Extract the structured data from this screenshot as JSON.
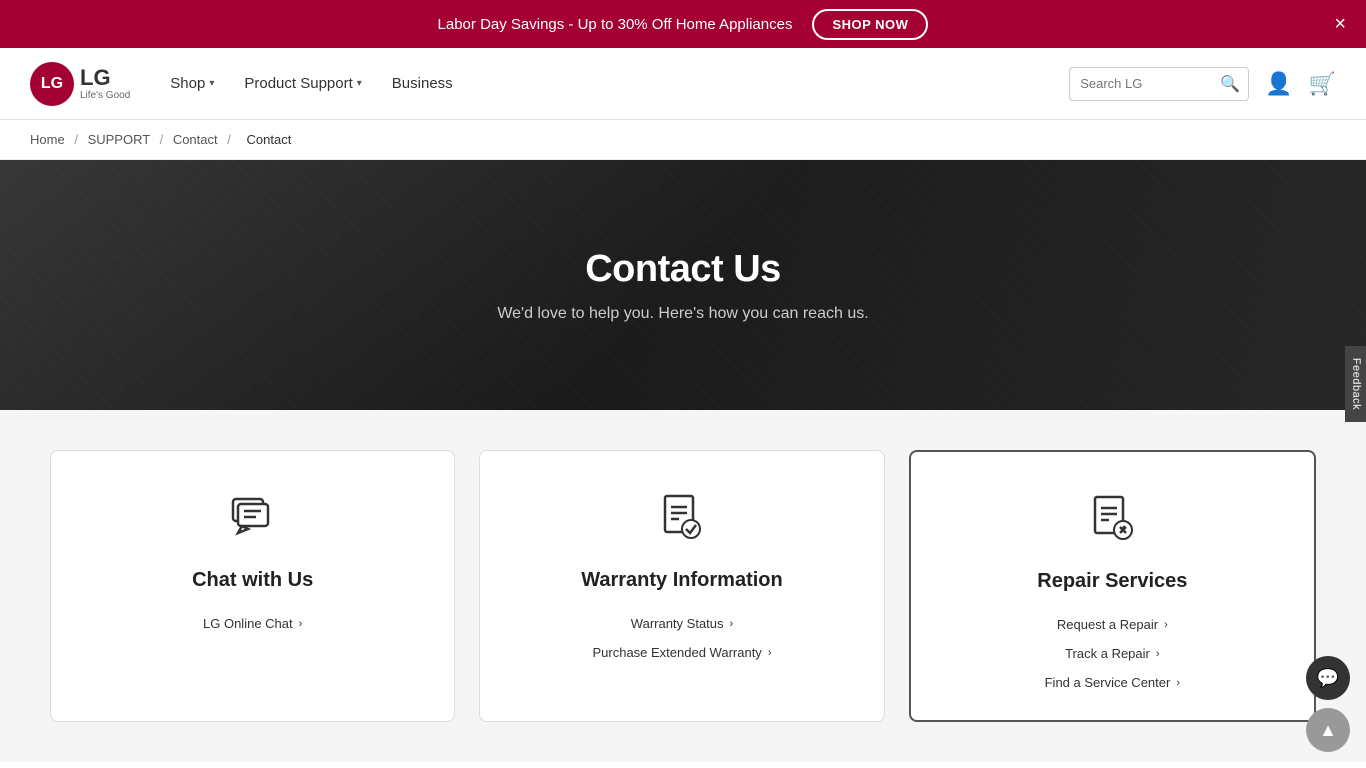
{
  "announcement": {
    "text": "Labor Day Savings - Up to 30% Off Home Appliances",
    "button_label": "SHOP NOW",
    "close_label": "×"
  },
  "header": {
    "logo_text": "LG",
    "logo_tagline": "Life's Good",
    "nav_items": [
      {
        "label": "Shop",
        "has_dropdown": true
      },
      {
        "label": "Product Support",
        "has_dropdown": true
      },
      {
        "label": "Business",
        "has_dropdown": false
      }
    ],
    "search_placeholder": "Search LG",
    "search_icon": "🔍"
  },
  "breadcrumb": {
    "items": [
      "Home",
      "SUPPORT",
      "Contact",
      "Contact"
    ]
  },
  "hero": {
    "title": "Contact Us",
    "subtitle": "We'd love to help you. Here's how you can reach us."
  },
  "feedback_label": "Feedback",
  "cards": [
    {
      "id": "chat",
      "title": "Chat with Us",
      "links": [
        {
          "label": "LG Online Chat",
          "url": "#"
        }
      ]
    },
    {
      "id": "warranty",
      "title": "Warranty Information",
      "links": [
        {
          "label": "Warranty Status",
          "url": "#"
        },
        {
          "label": "Purchase Extended Warranty",
          "url": "#"
        }
      ]
    },
    {
      "id": "repair",
      "title": "Repair Services",
      "links": [
        {
          "label": "Request a Repair",
          "url": "#"
        },
        {
          "label": "Track a Repair",
          "url": "#"
        },
        {
          "label": "Find a Service Center",
          "url": "#"
        }
      ]
    }
  ]
}
